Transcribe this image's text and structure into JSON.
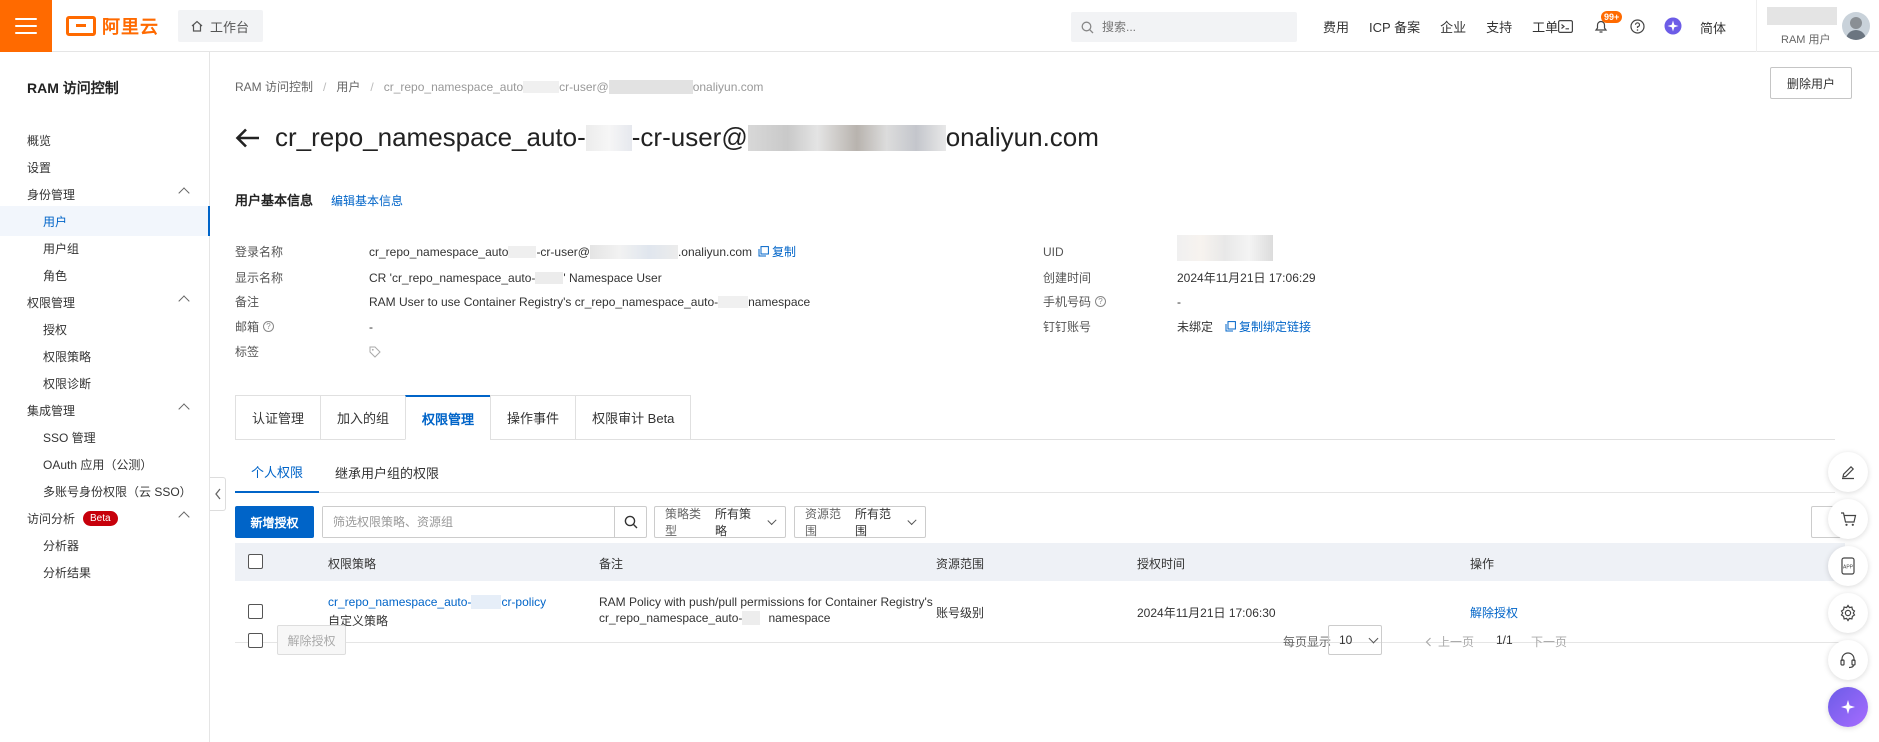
{
  "topbar": {
    "logo_text": "阿里云",
    "workbench_label": "工作台",
    "search_placeholder": "搜索...",
    "nav_links": [
      "费用",
      "ICP 备案",
      "企业",
      "支持",
      "工单"
    ],
    "notification_badge": "99+",
    "language": "简体",
    "user_label": "RAM 用户"
  },
  "sidebar": {
    "title": "RAM 访问控制",
    "items": [
      {
        "label": "概览"
      },
      {
        "label": "设置"
      },
      {
        "label": "身份管理"
      },
      {
        "label": "用户"
      },
      {
        "label": "用户组"
      },
      {
        "label": "角色"
      },
      {
        "label": "权限管理"
      },
      {
        "label": "授权"
      },
      {
        "label": "权限策略"
      },
      {
        "label": "权限诊断"
      },
      {
        "label": "集成管理"
      },
      {
        "label": "SSO 管理"
      },
      {
        "label": "OAuth 应用（公测）"
      },
      {
        "label": "多账号身份权限（云 SSO）"
      },
      {
        "label": "访问分析"
      },
      {
        "label": "分析器"
      },
      {
        "label": "分析结果"
      }
    ],
    "beta_badge": "Beta"
  },
  "breadcrumb": {
    "root": "RAM 访问控制",
    "users": "用户",
    "current_a": "cr_repo_namespace_auto",
    "current_b": "cr-user@",
    "current_c": "onaliyun.com"
  },
  "delete_user_label": "删除用户",
  "title": {
    "part1": "cr_repo_namespace_auto-",
    "part2": "-cr-user@",
    "part3": "onaliyun.com"
  },
  "basic_info": {
    "section_label": "用户基本信息",
    "edit_label": "编辑基本信息",
    "login_label": "登录名称",
    "login_a": "cr_repo_namespace_auto",
    "login_b": "-cr-user@",
    "login_c": ".onaliyun.com",
    "copy_label": "复制",
    "display_label": "显示名称",
    "display_a": "CR 'cr_repo_namespace_auto-",
    "display_b": "' Namespace User",
    "remark_label": "备注",
    "remark_a": "RAM User to use Container Registry's cr_repo_namespace_auto-",
    "remark_b": "namespace",
    "email_label": "邮箱",
    "email_value": "-",
    "tags_label": "标签",
    "uid_label": "UID",
    "created_label": "创建时间",
    "created_value": "2024年11月21日 17:06:29",
    "phone_label": "手机号码",
    "phone_value": "-",
    "dingtalk_label": "钉钉账号",
    "dingtalk_value": "未绑定",
    "copy_bind_label": "复制绑定链接"
  },
  "tabs": [
    "认证管理",
    "加入的组",
    "权限管理",
    "操作事件",
    "权限审计 Beta"
  ],
  "active_tab": 2,
  "subtabs": [
    "个人权限",
    "继承用户组的权限"
  ],
  "toolbar": {
    "add_grant": "新增授权",
    "filter_placeholder": "筛选权限策略、资源组",
    "policy_type_label": "策略类型",
    "policy_type_value": "所有策略",
    "scope_label": "资源范围",
    "scope_value": "所有范围"
  },
  "table": {
    "headers": [
      "权限策略",
      "备注",
      "资源范围",
      "授权时间",
      "操作"
    ],
    "rows": [
      {
        "policy_a": "cr_repo_namespace_auto-",
        "policy_b": "cr-policy",
        "policy_type": "自定义策略",
        "remark_line1": "RAM Policy with push/pull permissions for Container Registry's",
        "remark_line2a": "cr_repo_namespace_auto-",
        "remark_line2b": "namespace",
        "scope": "账号级别",
        "time": "2024年11月21日 17:06:30",
        "action": "解除授权"
      }
    ]
  },
  "footer": {
    "revoke_label": "解除授权",
    "per_page_label": "每页显示",
    "per_page_value": "10",
    "prev_label": "上一页",
    "page_num": "1/1",
    "next_label": "下一页"
  },
  "colors": {
    "brand": "#ff6a00",
    "primary": "#0064c8",
    "beta": "#c7000b"
  }
}
